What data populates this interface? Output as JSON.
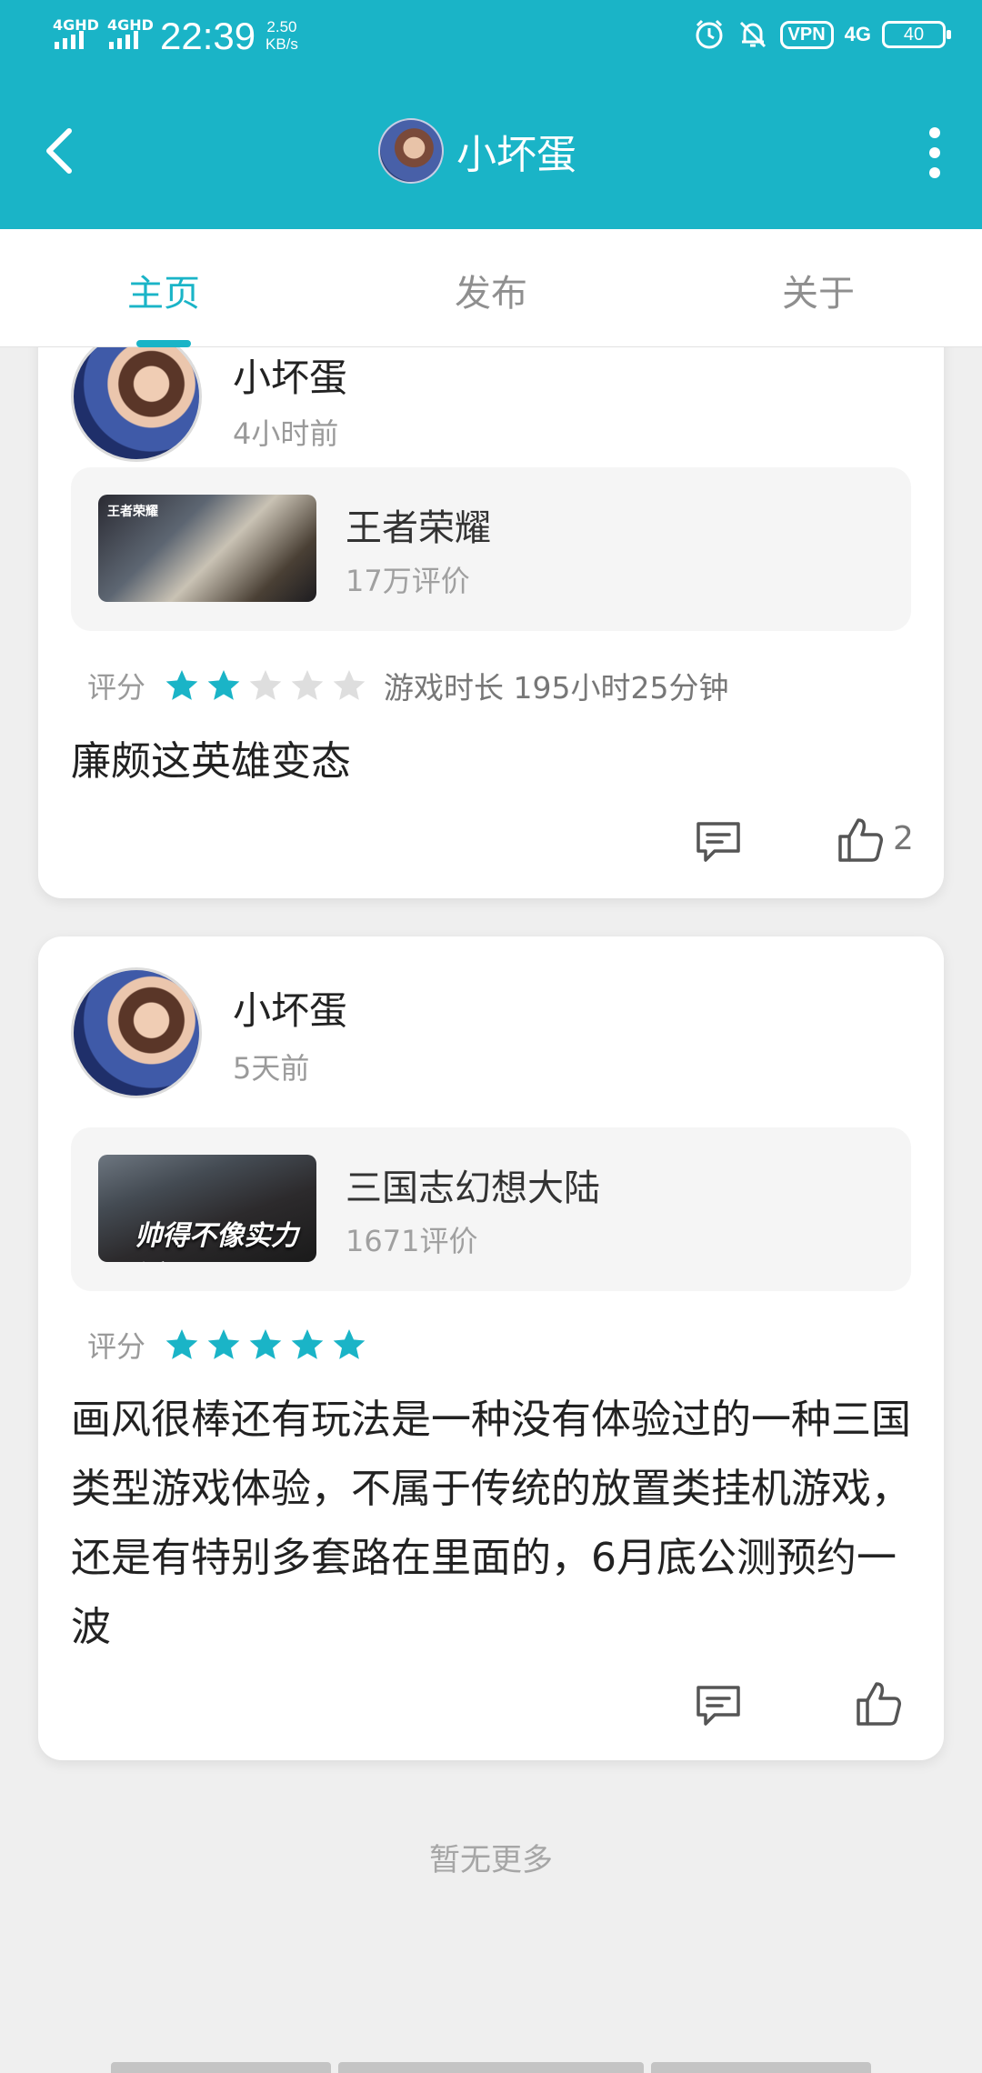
{
  "status_bar": {
    "signal1_label": "4GHD",
    "signal2_label": "4GHD",
    "time": "22:39",
    "speed_value": "2.50",
    "speed_unit": "KB/s",
    "vpn": "VPN",
    "network": "4G",
    "battery": "40"
  },
  "header": {
    "title": "小坏蛋"
  },
  "tabs": [
    {
      "label": "主页",
      "active": true
    },
    {
      "label": "发布",
      "active": false
    },
    {
      "label": "关于",
      "active": false
    }
  ],
  "posts": [
    {
      "username": "小坏蛋",
      "time_ago": "4小时前",
      "game": {
        "name": "王者荣耀",
        "reviews": "17万评价",
        "thumb_logo": "王者荣耀"
      },
      "rating_label": "评分",
      "stars": 2,
      "playtime": "游戏时长 195小时25分钟",
      "body": "廉颇这英雄变态",
      "like_count": "2"
    },
    {
      "username": "小坏蛋",
      "time_ago": "5天前",
      "game": {
        "name": "三国志幻想大陆",
        "reviews": "1671评价",
        "thumb_slogan": "帅得不像实力派"
      },
      "rating_label": "评分",
      "stars": 5,
      "playtime": "",
      "body": "画风很棒还有玩法是一种没有体验过的一种三国类型游戏体验，不属于传统的放置类挂机游戏，还是有特别多套路在里面的，6月底公测预约一波",
      "like_count": ""
    }
  ],
  "footer": {
    "no_more": "暂无更多"
  },
  "colors": {
    "accent": "#1ab4c7",
    "star_empty": "#dedede"
  },
  "icons": [
    "back-arrow-icon",
    "more-vertical-icon",
    "alarm-icon",
    "bell-off-icon",
    "comment-icon",
    "thumbs-up-icon",
    "star-icon"
  ]
}
